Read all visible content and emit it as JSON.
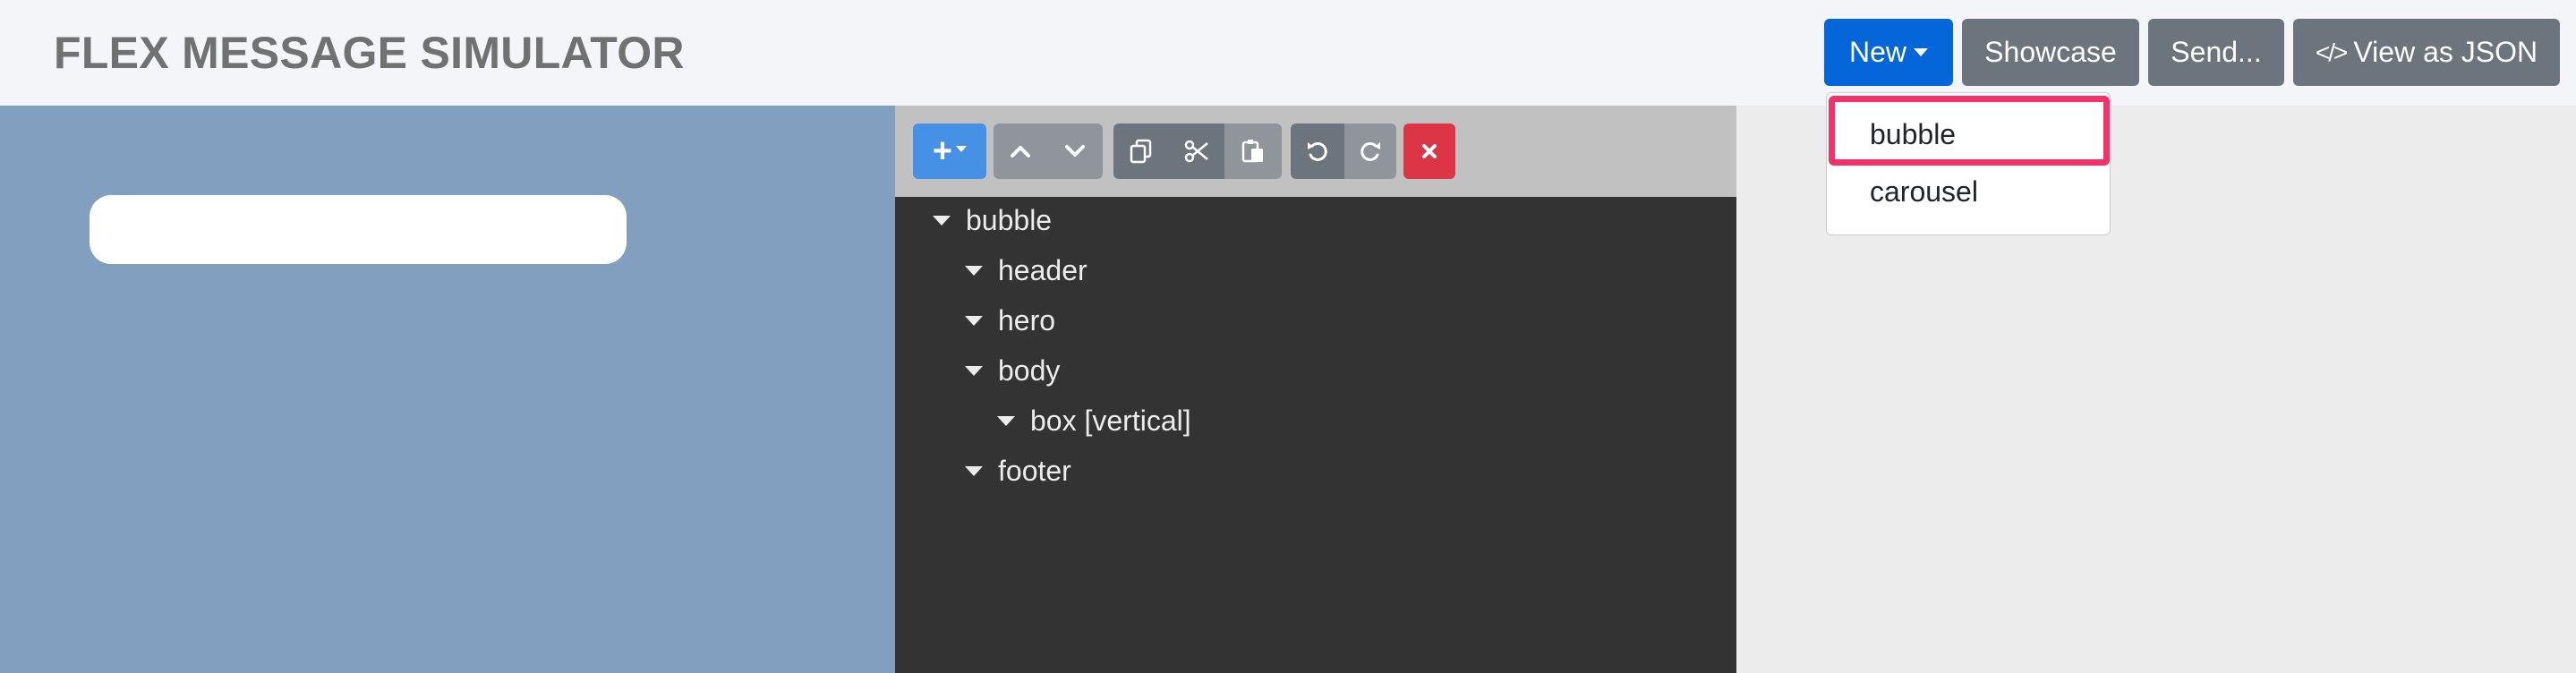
{
  "header": {
    "title": "FLEX MESSAGE SIMULATOR",
    "buttons": {
      "new": "New",
      "showcase": "Showcase",
      "send": "Send...",
      "view_json_icon": "</>",
      "view_json": "View as JSON"
    }
  },
  "new_menu": {
    "items": [
      "bubble",
      "carousel"
    ],
    "highlighted": "bubble"
  },
  "toolbar": {
    "add": "+",
    "icons": [
      "add-icon",
      "move-up-icon",
      "move-down-icon",
      "copy-icon",
      "cut-icon",
      "paste-icon",
      "undo-icon",
      "redo-icon",
      "delete-icon"
    ]
  },
  "tree": [
    {
      "label": "bubble",
      "level": 0
    },
    {
      "label": "header",
      "level": 1
    },
    {
      "label": "hero",
      "level": 1
    },
    {
      "label": "body",
      "level": 1
    },
    {
      "label": "box [vertical]",
      "level": 2
    },
    {
      "label": "footer",
      "level": 1
    }
  ],
  "colors": {
    "primary": "#0466d8",
    "secondary": "#6c757d",
    "danger": "#dc3545",
    "highlight": "#f5306b",
    "preview_bg": "#829fc0",
    "editor_bg": "#333333"
  }
}
